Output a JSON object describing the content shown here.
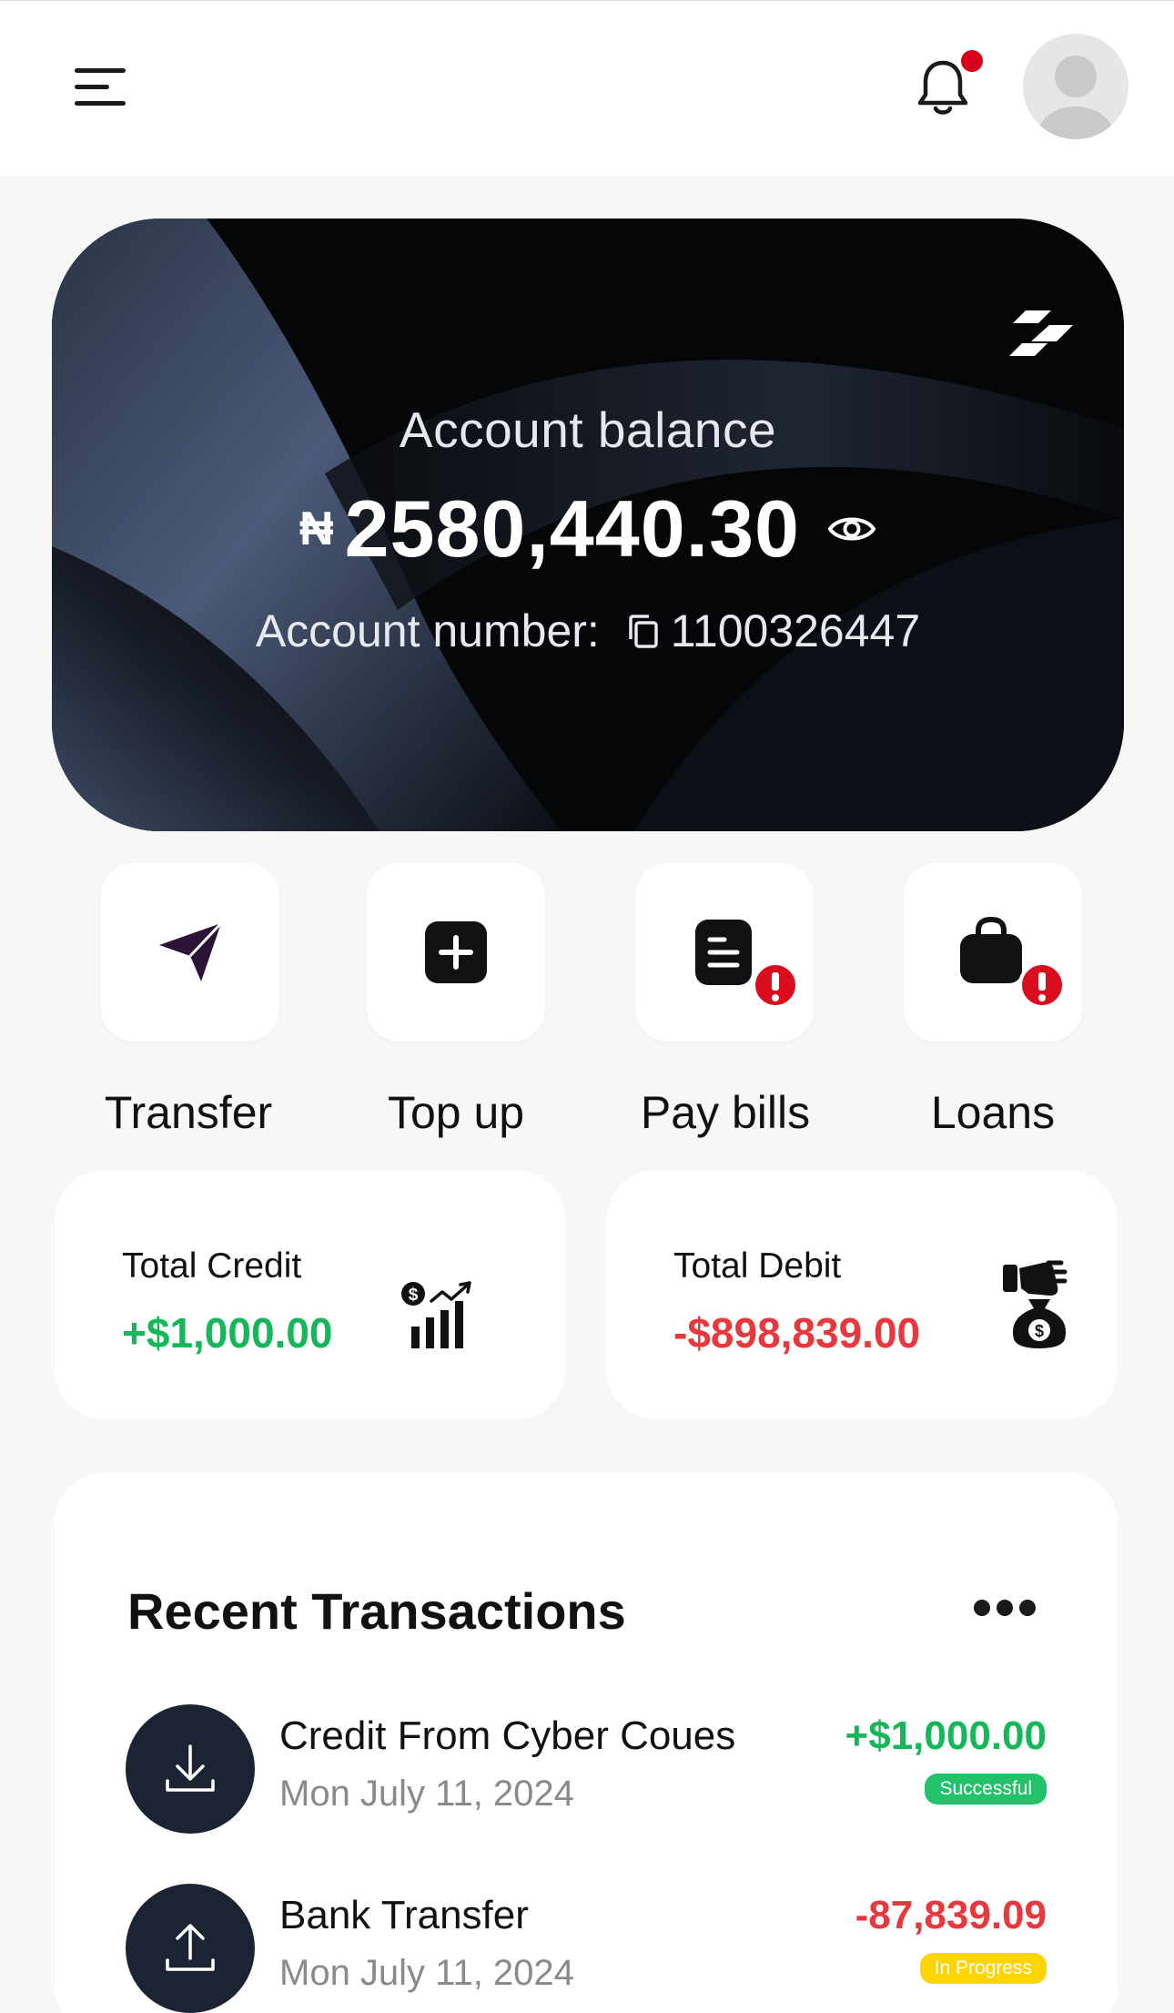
{
  "header": {
    "menu_icon": "hamburger-menu-icon",
    "notification_icon": "bell-icon",
    "has_unread_notification": true,
    "avatar_icon": "user-avatar-icon"
  },
  "balance_card": {
    "label": "Account balance",
    "currency_symbol": "₦",
    "amount": "2580,440.30",
    "visibility_icon": "eye-icon",
    "account_number_label": "Account number:",
    "copy_icon": "copy-icon",
    "account_number": "1100326447",
    "logo_icon": "brand-logo-icon"
  },
  "quick_actions": [
    {
      "label": "Transfer",
      "icon": "send-icon",
      "alert": false
    },
    {
      "label": "Top up",
      "icon": "plus-square-icon",
      "alert": false
    },
    {
      "label": "Pay bills",
      "icon": "bill-icon",
      "alert": true
    },
    {
      "label": "Loans",
      "icon": "bag-icon",
      "alert": true
    }
  ],
  "summary": {
    "credit": {
      "title": "Total Credit",
      "value": "+$1,000.00",
      "icon": "money-growth-chart-icon"
    },
    "debit": {
      "title": "Total Debit",
      "value": "-$898,839.00",
      "icon": "hand-money-bag-icon"
    }
  },
  "transactions": {
    "title": "Recent Transactions",
    "more_icon": "more-dots-icon",
    "items": [
      {
        "name": "Credit From Cyber Coues",
        "date": "Mon July 11, 2024",
        "amount": "+$1,000.00",
        "status": "Successful",
        "direction_icon": "download-icon"
      },
      {
        "name": "Bank Transfer",
        "date": "Mon July 11, 2024",
        "amount": "-87,839.09",
        "status": "In Progress",
        "direction_icon": "upload-icon"
      }
    ]
  },
  "colors": {
    "credit_green": "#16b65a",
    "debit_red": "#e8383d",
    "success_badge": "#21c26a",
    "progress_badge": "#ffd400",
    "alert_red": "#d90d1d",
    "card_dark": "#050608",
    "tx_icon_bg": "#1c2333"
  }
}
